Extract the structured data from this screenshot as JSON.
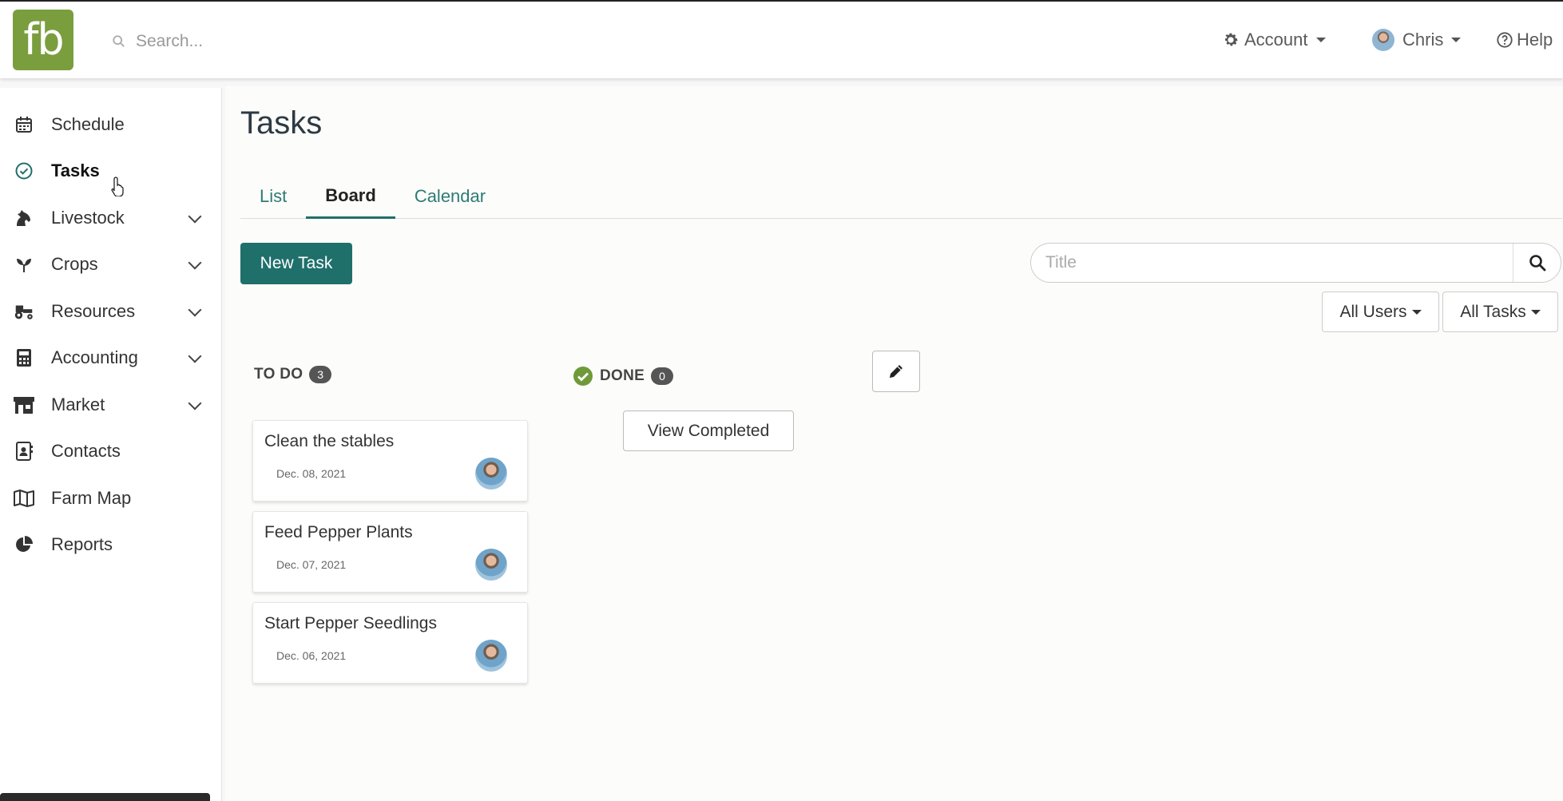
{
  "header": {
    "logo_text": "fb",
    "search_placeholder": "Search...",
    "account_label": "Account",
    "user_label": "Chris",
    "help_label": "Help"
  },
  "sidebar": {
    "items": [
      {
        "label": "Schedule",
        "icon": "calendar-icon",
        "expandable": false
      },
      {
        "label": "Tasks",
        "icon": "check-circle-icon",
        "expandable": false,
        "active": true
      },
      {
        "label": "Livestock",
        "icon": "horse-icon",
        "expandable": true
      },
      {
        "label": "Crops",
        "icon": "seedling-icon",
        "expandable": true
      },
      {
        "label": "Resources",
        "icon": "tractor-icon",
        "expandable": true
      },
      {
        "label": "Accounting",
        "icon": "calculator-icon",
        "expandable": true
      },
      {
        "label": "Market",
        "icon": "store-icon",
        "expandable": true
      },
      {
        "label": "Contacts",
        "icon": "address-book-icon",
        "expandable": false
      },
      {
        "label": "Farm Map",
        "icon": "map-icon",
        "expandable": false
      },
      {
        "label": "Reports",
        "icon": "pie-chart-icon",
        "expandable": false
      }
    ]
  },
  "main": {
    "title": "Tasks",
    "tabs": [
      {
        "label": "List",
        "active": false
      },
      {
        "label": "Board",
        "active": true
      },
      {
        "label": "Calendar",
        "active": false
      }
    ],
    "new_task_label": "New Task",
    "title_search_placeholder": "Title",
    "filter_users": "All Users",
    "filter_tasks": "All Tasks",
    "columns": [
      {
        "label": "TO DO",
        "count": "3"
      },
      {
        "label": "DONE",
        "count": "0"
      }
    ],
    "view_completed_label": "View Completed",
    "cards": [
      {
        "title": "Clean the stables",
        "date": "Dec. 08, 2021"
      },
      {
        "title": "Feed Pepper Plants",
        "date": "Dec. 07, 2021"
      },
      {
        "title": "Start Pepper Seedlings",
        "date": "Dec. 06, 2021"
      }
    ]
  },
  "colors": {
    "brand_green": "#7a9e3e",
    "primary_teal": "#1f6f6b",
    "done_green": "#6f9a3a"
  }
}
